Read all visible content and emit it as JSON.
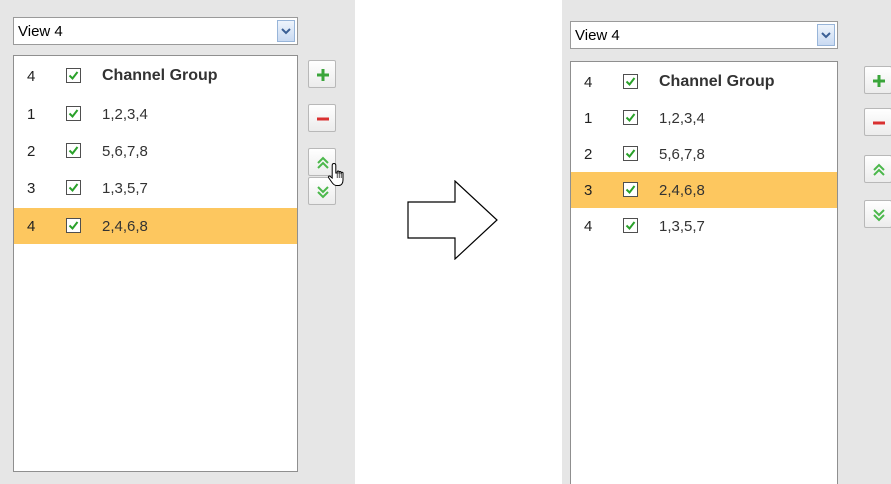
{
  "before": {
    "view_select": {
      "value": "View 4"
    },
    "header": {
      "count": "4",
      "label": "Channel Group"
    },
    "rows": [
      {
        "num": "1",
        "label": "1,2,3,4",
        "selected": false
      },
      {
        "num": "2",
        "label": "5,6,7,8",
        "selected": false
      },
      {
        "num": "3",
        "label": "1,3,5,7",
        "selected": false
      },
      {
        "num": "4",
        "label": "2,4,6,8",
        "selected": true
      }
    ]
  },
  "after": {
    "view_select": {
      "value": "View 4"
    },
    "header": {
      "count": "4",
      "label": "Channel Group"
    },
    "rows": [
      {
        "num": "1",
        "label": "1,2,3,4",
        "selected": false
      },
      {
        "num": "2",
        "label": "5,6,7,8",
        "selected": false
      },
      {
        "num": "3",
        "label": "2,4,6,8",
        "selected": true
      },
      {
        "num": "4",
        "label": "1,3,5,7",
        "selected": false
      }
    ]
  },
  "icons": {
    "add": "plus-icon",
    "remove": "minus-icon",
    "move_up": "double-chevron-up-icon",
    "move_down": "double-chevron-down-icon",
    "transition": "right-arrow-icon",
    "cursor": "hand-pointer-icon"
  },
  "colors": {
    "selected_row": "#fdc75f",
    "checkmark": "#2aa12a",
    "add_icon": "#3aa53a",
    "remove_icon": "#d93030",
    "move_icon": "#4cb84c",
    "panel_bg": "#e6e6e6"
  }
}
